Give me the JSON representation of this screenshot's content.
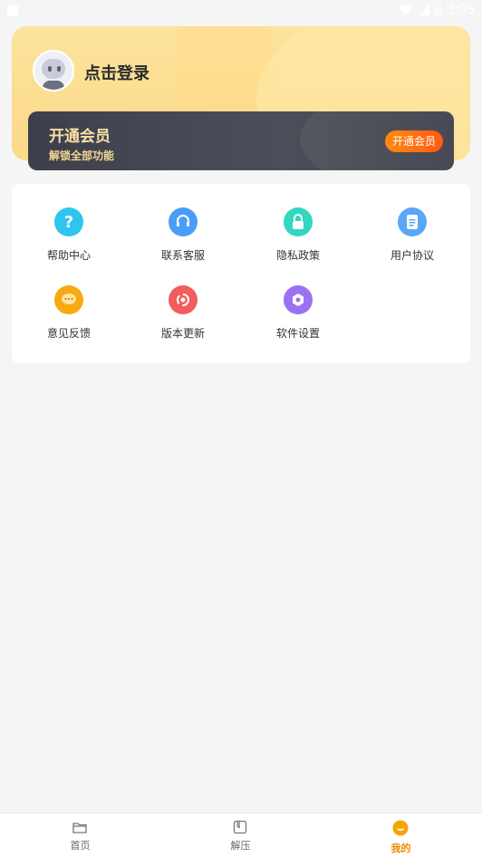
{
  "status_bar": {
    "time": "3:05"
  },
  "header": {
    "login_text": "点击登录",
    "vip": {
      "title": "开通会员",
      "subtitle": "解锁全部功能",
      "button": "开通会员"
    }
  },
  "menu": {
    "items": [
      {
        "label": "帮助中心",
        "icon": "help-icon",
        "color": "#2ec5f1",
        "glyph": "?"
      },
      {
        "label": "联系客服",
        "icon": "customer-service-icon",
        "color": "#4a9df5",
        "glyph": "☎"
      },
      {
        "label": "隐私政策",
        "icon": "lock-icon",
        "color": "#33d6be",
        "glyph": "🔒"
      },
      {
        "label": "用户协议",
        "icon": "document-icon",
        "color": "#5aa7f7",
        "glyph": "≡"
      },
      {
        "label": "意见反馈",
        "icon": "feedback-icon",
        "color": "#f9a90f",
        "glyph": "…"
      },
      {
        "label": "版本更新",
        "icon": "update-icon",
        "color": "#f15d5d",
        "glyph": "↻"
      },
      {
        "label": "软件设置",
        "icon": "settings-icon",
        "color": "#9b72f2",
        "glyph": "⚙"
      }
    ]
  },
  "bottom_nav": {
    "items": [
      {
        "label": "首页",
        "icon": "folder-icon",
        "active": false
      },
      {
        "label": "解压",
        "icon": "archive-icon",
        "active": false
      },
      {
        "label": "我的",
        "icon": "profile-smile-icon",
        "active": true
      }
    ],
    "active_color": "#f08a00"
  }
}
